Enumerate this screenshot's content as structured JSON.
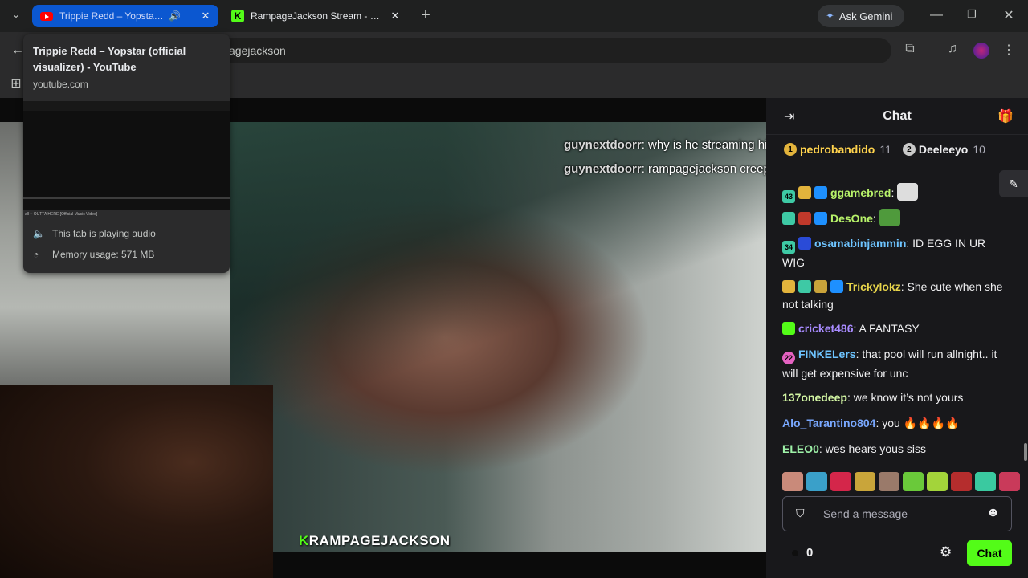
{
  "browser": {
    "tabs": [
      {
        "title": "Trippie Redd – Yopstar (official visualizer) - YouTube",
        "active": true,
        "audio": true
      },
      {
        "title": "RampageJackson Stream - Watch Live on Kick",
        "active": false
      }
    ],
    "new_tab_label": "+",
    "gemini_label": "Ask Gemini",
    "url": "kick.com/rampagejackson",
    "url_visible": "agejackson"
  },
  "hover_card": {
    "title": "Trippie Redd – Yopstar (official visualizer) - YouTube",
    "domain": "youtube.com",
    "audio_status": "This tab is playing audio",
    "memory_usage": "Memory usage: 571 MB",
    "preview_caption": "all ~ OUTTA HERE [Official Music Video]"
  },
  "stream": {
    "overlay_messages": [
      {
        "user": "guynextdoorr",
        "text": "why is he streaming his daughter"
      },
      {
        "user": "guynextdoorr",
        "text": "rampagejackson creeping on his daughter"
      }
    ],
    "watermark_prefix": "K",
    "watermark_text": "RAMPAGEJACKSON"
  },
  "chat": {
    "title": "Chat",
    "top_gifters": [
      {
        "name": "pedrobandido",
        "count": "11",
        "rank": "1"
      },
      {
        "name": "Deeleeyo",
        "count": "10",
        "rank": "2"
      }
    ],
    "messages": [
      {
        "user": "ggamebred",
        "color": "#b8f36a",
        "text": ""
      },
      {
        "user": "DesOne",
        "color": "#b8f36a",
        "text": ""
      },
      {
        "user": "osamabinjammin",
        "color": "#6ec4ff",
        "text": "ID EGG IN UR WIG"
      },
      {
        "user": "Trickylokz",
        "color": "#e7d44b",
        "text": "She cute when she not talking"
      },
      {
        "user": "cricket486",
        "color": "#a88bff",
        "text": "A FANTASY"
      },
      {
        "user": "FINKELers",
        "color": "#6ec4ff",
        "text": "that pool will run allnight.. it will get expensive for unc"
      },
      {
        "user": "137onedeep",
        "color": "#d2f5a3",
        "text": "we know it’s not yours"
      },
      {
        "user": "Alo_Tarantino804",
        "color": "#79a8ff",
        "text": "you 🔥🔥🔥🔥"
      },
      {
        "user": "ELEO0",
        "color": "#9ef2a8",
        "text": "wes hears yous siss"
      }
    ],
    "input_placeholder": "Send a message",
    "viewer_count": "0",
    "send_label": "Chat"
  },
  "colors": {
    "kick_green": "#53fc18",
    "active_tab": "#0b57d0"
  }
}
